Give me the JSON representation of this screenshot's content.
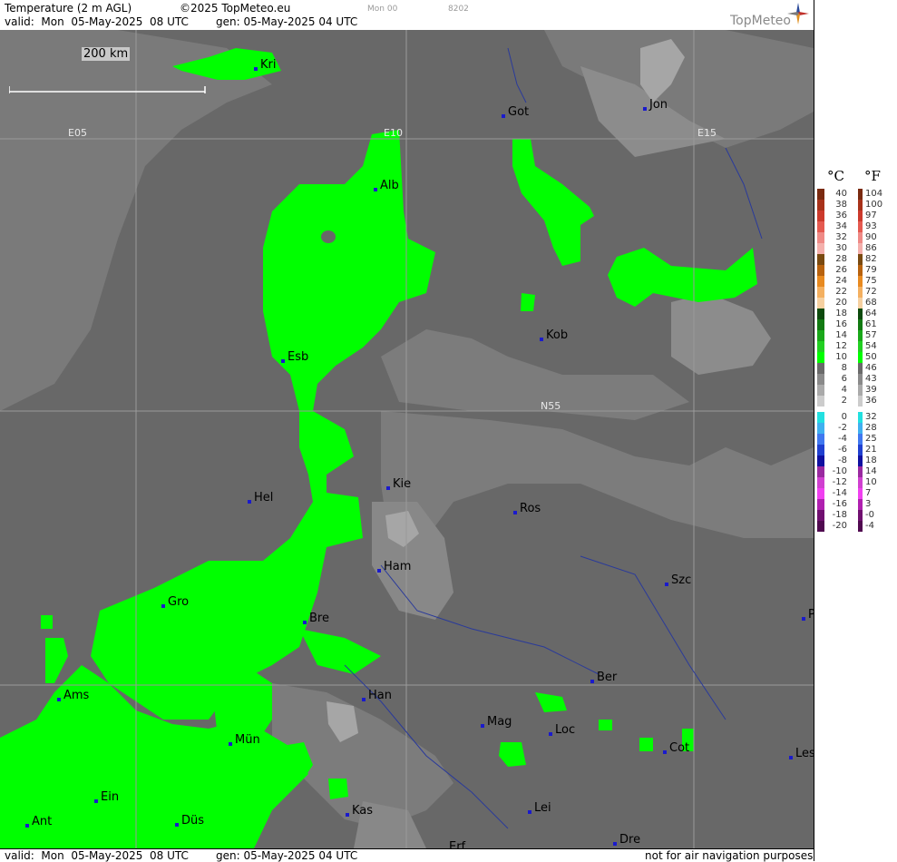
{
  "header": {
    "product": "Temperature (2 m AGL)",
    "copyright": "©2025 TopMeteo.eu",
    "day_code": "Mon 00",
    "code": "8202",
    "valid": "valid:  Mon  05-May-2025  08 UTC",
    "gen": "gen: 05-May-2025 04 UTC",
    "logo": "TopMeteo"
  },
  "footer": {
    "valid": "valid:  Mon  05-May-2025  08 UTC",
    "gen": "gen: 05-May-2025 04 UTC",
    "disclaimer": "not for air navigation purposes"
  },
  "map": {
    "scale_label": "200 km",
    "grid_labels": [
      "E05",
      "E10",
      "E15",
      "N55"
    ],
    "cities": [
      "Kri",
      "Got",
      "Jon",
      "Alb",
      "Kob",
      "Esb",
      "Kie",
      "Hel",
      "Ros",
      "Ham",
      "Szc",
      "Gro",
      "Bre",
      "P",
      "Ams",
      "Han",
      "Ber",
      "Mag",
      "Loc",
      "Mün",
      "Cot",
      "Les",
      "Ein",
      "Kas",
      "Lei",
      "Ant",
      "Düs",
      "Dre",
      "Erf"
    ]
  },
  "legend": {
    "celsius_header": "°C",
    "fahrenheit_header": "°F",
    "celsius": [
      "40",
      "38",
      "36",
      "34",
      "32",
      "30",
      "28",
      "26",
      "24",
      "22",
      "20",
      "18",
      "16",
      "14",
      "12",
      "10",
      "8",
      "6",
      "4",
      "2",
      "0",
      "-2",
      "-4",
      "-6",
      "-8",
      "-10",
      "-12",
      "-14",
      "-16",
      "-18",
      "-20"
    ],
    "fahrenheit": [
      "104",
      "100",
      "97",
      "93",
      "90",
      "86",
      "82",
      "79",
      "75",
      "72",
      "68",
      "64",
      "61",
      "57",
      "54",
      "50",
      "46",
      "43",
      "39",
      "36",
      "32",
      "28",
      "25",
      "21",
      "18",
      "14",
      "10",
      "7",
      "3",
      "-0",
      "-4"
    ],
    "colors": [
      "#7a2a10",
      "#a8321a",
      "#cc3a2c",
      "#e55a50",
      "#ef8a86",
      "#f4b0ac",
      "#7a4a10",
      "#b8620e",
      "#e88a20",
      "#f4b060",
      "#f6d0a0",
      "#0d4a0d",
      "#127a12",
      "#1aa81a",
      "#22d022",
      "#00ff00",
      "#6a6a6a",
      "#8a8a8a",
      "#aaaaaa",
      "#cccccc",
      "#22e0e0",
      "#40b0f0",
      "#4078f0",
      "#2040d0",
      "#1010a0",
      "#9a2aa0",
      "#d040d0",
      "#f040f0",
      "#b020b0",
      "#701070",
      "#500a50"
    ]
  }
}
